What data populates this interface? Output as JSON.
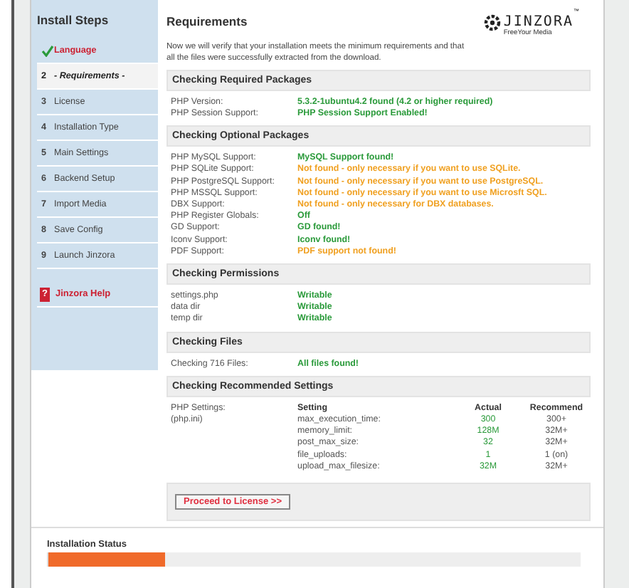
{
  "sidebar": {
    "title": "Install Steps",
    "steps": [
      {
        "label": "Language",
        "kind": "done"
      },
      {
        "number": "2",
        "label": "- Requirements -",
        "kind": "current"
      },
      {
        "number": "3",
        "label": "License",
        "kind": "pending"
      },
      {
        "number": "4",
        "label": "Installation Type",
        "kind": "pending"
      },
      {
        "number": "5",
        "label": "Main Settings",
        "kind": "pending"
      },
      {
        "number": "6",
        "label": "Backend Setup",
        "kind": "pending"
      },
      {
        "number": "7",
        "label": "Import Media",
        "kind": "pending"
      },
      {
        "number": "8",
        "label": "Save Config",
        "kind": "pending"
      },
      {
        "number": "9",
        "label": "Launch Jinzora",
        "kind": "pending"
      }
    ],
    "help": {
      "icon": "?",
      "label": "Jinzora Help"
    }
  },
  "logo": {
    "name": "JINZORA",
    "tm": "™",
    "tagline": "FreeYour Media"
  },
  "title": "Requirements",
  "intro": "Now we will verify that your installation meets the minimum requirements and that all the files were successfully extracted from the download.",
  "sections": [
    {
      "heading": "Checking Required Packages",
      "rows": [
        {
          "label": "PHP Version:",
          "value": "5.3.2-1ubuntu4.2 found (4.2 or higher required)",
          "kind": "ok"
        },
        {
          "label": "PHP Session Support:",
          "value": "PHP Session Support Enabled!",
          "kind": "ok"
        }
      ]
    },
    {
      "heading": "Checking Optional Packages",
      "rows": [
        {
          "label": "PHP MySQL Support:",
          "value": "MySQL Support found!",
          "kind": "ok"
        },
        {
          "label": "PHP SQLite Support:",
          "value": "Not found - only necessary if you want to use SQLite.",
          "kind": "warn"
        },
        {
          "label": "PHP PostgreSQL Support:",
          "value": "Not found - only necessary if you want to use PostgreSQL.",
          "kind": "warn"
        },
        {
          "label": "PHP MSSQL Support:",
          "value": "Not found - only necessary if you want to use Microsft SQL.",
          "kind": "warn"
        },
        {
          "label": "DBX Support:",
          "value": "Not found - only necessary for DBX databases.",
          "kind": "warn"
        },
        {
          "label": "PHP Register Globals:",
          "value": "Off",
          "kind": "ok"
        },
        {
          "label": "GD Support:",
          "value": "GD found!",
          "kind": "ok"
        },
        {
          "label": "Iconv Support:",
          "value": "Iconv found!",
          "kind": "ok"
        },
        {
          "label": "PDF Support:",
          "value": "PDF support not found!",
          "kind": "warn"
        }
      ]
    },
    {
      "heading": "Checking Permissions",
      "rows": [
        {
          "label": "settings.php",
          "value": "Writable",
          "kind": "ok"
        },
        {
          "label": "data dir",
          "value": "Writable",
          "kind": "ok"
        },
        {
          "label": "temp dir",
          "value": "Writable",
          "kind": "ok"
        }
      ]
    },
    {
      "heading": "Checking Files",
      "rows": [
        {
          "label": "Checking 716 Files:",
          "value": "All files found!",
          "kind": "ok"
        }
      ]
    }
  ],
  "settings": {
    "heading": "Checking Recommended Settings",
    "labels": [
      "PHP Settings:",
      "(php.ini)"
    ],
    "columns": [
      "Setting",
      "Actual",
      "Recommend"
    ],
    "rows": [
      [
        "max_execution_time:",
        "300",
        "300+"
      ],
      [
        "memory_limit:",
        "128M",
        "32M+"
      ],
      [
        "post_max_size:",
        "32",
        "32M+"
      ],
      [
        "file_uploads:",
        "1",
        "1 (on)"
      ],
      [
        "upload_max_filesize:",
        "32M",
        "32M+"
      ]
    ]
  },
  "proceed_button": "Proceed to License >>",
  "status": {
    "title": "Installation Status",
    "level": 0.22
  }
}
